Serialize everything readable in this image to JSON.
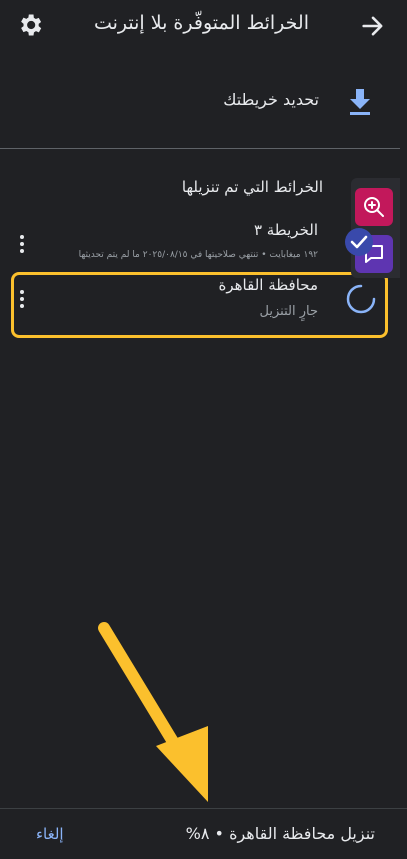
{
  "header": {
    "title": "الخرائط المتوفّرة بلا إنترنت",
    "back_icon": "arrow-right-icon",
    "settings_icon": "gear-icon"
  },
  "update": {
    "label": "تحديد خريطتك",
    "icon": "download-icon"
  },
  "section": {
    "title": "الخرائط التي تم تنزيلها"
  },
  "maps": [
    {
      "title": "الخريطة ٣",
      "subtitle": "١٩٢ ميغابايت • تنتهي صلاحيتها في ٢٠٢٥/٠٨/١٥ ما لم يتم تحديثها"
    },
    {
      "title": "محافظة القاهرة",
      "subtitle": "جارٍ التنزيل",
      "progress_percent": 8
    }
  ],
  "bottom_bar": {
    "status": "تنزيل محافظة القاهرة • ٨%",
    "cancel_label": "إلغاء"
  },
  "colors": {
    "background": "#202124",
    "highlight": "#fbc02d",
    "accent": "#8ab4f8",
    "zoom_button": "#c2185b",
    "chat_button": "#5e35b1"
  }
}
